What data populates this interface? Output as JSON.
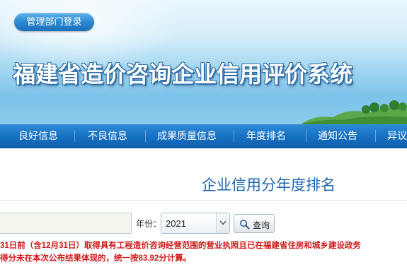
{
  "header": {
    "login_button": "管理部门登录",
    "title": "福建省造价咨询企业信用评价系统"
  },
  "nav": {
    "items": [
      "良好信息",
      "不良信息",
      "成果质量信息",
      "年度排名",
      "通知公告",
      "异议"
    ]
  },
  "main": {
    "heading": "企业信用分年度排名",
    "search_input": {
      "value": "",
      "placeholder": ""
    },
    "year_label": "年份：",
    "year_value": "2021",
    "query_button": "查询",
    "notice_lines": [
      "31日前（含12月31日）取得具有工程造价咨询经营范围的营业执照且已在福建省住房和城乡建设政务",
      "得分未在本次公布结果体现的，统一按83.92分计算。"
    ]
  },
  "colors": {
    "nav_blue": "#1670c2",
    "heading_blue": "#1e67b0",
    "notice_red": "#d01818",
    "login_button_blue": "#2a86cf"
  },
  "icons": {
    "search": "magnifier-icon",
    "dropdown": "chevron-down-icon"
  }
}
